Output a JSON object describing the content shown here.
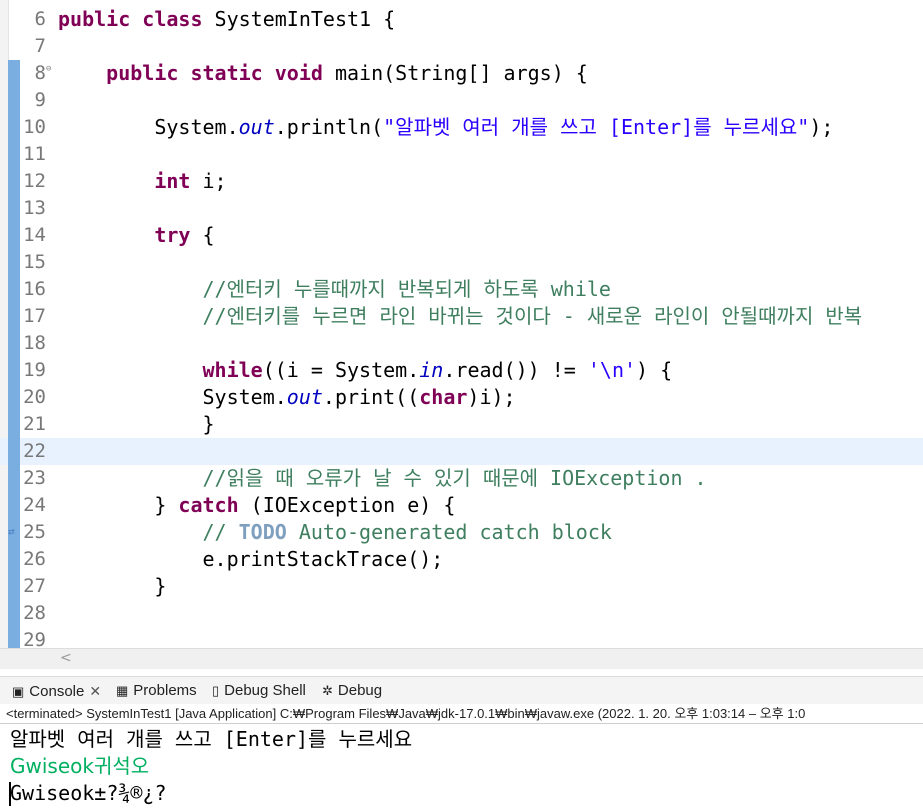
{
  "editor": {
    "lines": [
      {
        "n": "6",
        "tokens": [
          {
            "t": "public class",
            "c": "kw"
          },
          {
            "t": " SystemInTest1 {",
            "c": ""
          }
        ]
      },
      {
        "n": "7",
        "tokens": []
      },
      {
        "n": "8",
        "fold": "⊖",
        "tokens": [
          {
            "t": "    ",
            "c": ""
          },
          {
            "t": "public static void",
            "c": "kw"
          },
          {
            "t": " main(String[] args) {",
            "c": ""
          }
        ]
      },
      {
        "n": "9",
        "tokens": []
      },
      {
        "n": "10",
        "tokens": [
          {
            "t": "        System.",
            "c": ""
          },
          {
            "t": "out",
            "c": "fld"
          },
          {
            "t": ".println(",
            "c": ""
          },
          {
            "t": "\"알파벳 여러 개를 쓰고 [Enter]를 누르세요\"",
            "c": "str"
          },
          {
            "t": ");",
            "c": ""
          }
        ]
      },
      {
        "n": "11",
        "tokens": []
      },
      {
        "n": "12",
        "tokens": [
          {
            "t": "        ",
            "c": ""
          },
          {
            "t": "int",
            "c": "kw"
          },
          {
            "t": " i;",
            "c": ""
          }
        ]
      },
      {
        "n": "13",
        "tokens": []
      },
      {
        "n": "14",
        "tokens": [
          {
            "t": "        ",
            "c": ""
          },
          {
            "t": "try",
            "c": "kw"
          },
          {
            "t": " {",
            "c": ""
          }
        ]
      },
      {
        "n": "15",
        "tokens": []
      },
      {
        "n": "16",
        "tokens": [
          {
            "t": "            //엔터키 누를때까지 반복되게 하도록 while",
            "c": "cmt"
          }
        ]
      },
      {
        "n": "17",
        "tokens": [
          {
            "t": "            //엔터키를 누르면 라인 바뀌는 것이다 - 새로운 라인이 안될때까지 반복",
            "c": "cmt"
          }
        ]
      },
      {
        "n": "18",
        "tokens": []
      },
      {
        "n": "19",
        "tokens": [
          {
            "t": "            ",
            "c": ""
          },
          {
            "t": "while",
            "c": "kw"
          },
          {
            "t": "((i = System.",
            "c": ""
          },
          {
            "t": "in",
            "c": "fld"
          },
          {
            "t": ".read()) != ",
            "c": ""
          },
          {
            "t": "'\\n'",
            "c": "str"
          },
          {
            "t": ") {",
            "c": ""
          }
        ]
      },
      {
        "n": "20",
        "tokens": [
          {
            "t": "            System.",
            "c": ""
          },
          {
            "t": "out",
            "c": "fld"
          },
          {
            "t": ".print((",
            "c": ""
          },
          {
            "t": "char",
            "c": "kw"
          },
          {
            "t": ")i);",
            "c": ""
          }
        ]
      },
      {
        "n": "21",
        "tokens": [
          {
            "t": "            }",
            "c": ""
          }
        ]
      },
      {
        "n": "22",
        "current": true,
        "tokens": []
      },
      {
        "n": "23",
        "tokens": [
          {
            "t": "            //읽을 때 오류가 날 수 있기 때문에 IOException .",
            "c": "cmt"
          }
        ]
      },
      {
        "n": "24",
        "tokens": [
          {
            "t": "        } ",
            "c": ""
          },
          {
            "t": "catch",
            "c": "kw"
          },
          {
            "t": " (IOException e) {",
            "c": ""
          }
        ]
      },
      {
        "n": "25",
        "ann": "⇄",
        "tokens": [
          {
            "t": "            // ",
            "c": "cmt"
          },
          {
            "t": "TODO",
            "c": "todo"
          },
          {
            "t": " Auto-generated catch block",
            "c": "cmt"
          }
        ]
      },
      {
        "n": "26",
        "tokens": [
          {
            "t": "            e.printStackTrace();",
            "c": ""
          }
        ]
      },
      {
        "n": "27",
        "tokens": [
          {
            "t": "        }",
            "c": ""
          }
        ]
      },
      {
        "n": "28",
        "tokens": []
      },
      {
        "n": "29",
        "tokens": []
      }
    ]
  },
  "scroll": {
    "left_arrow": "<"
  },
  "tabs": [
    {
      "icon": "▣",
      "label": "Console",
      "close": "✕",
      "icon_name": "console-icon"
    },
    {
      "icon": "▦",
      "label": "Problems",
      "icon_name": "problems-icon"
    },
    {
      "icon": "▯",
      "label": "Debug Shell",
      "icon_name": "debug-shell-icon"
    },
    {
      "icon": "✲",
      "label": "Debug",
      "icon_name": "debug-icon"
    }
  ],
  "status": "<terminated> SystemInTest1 [Java Application] C:₩Program Files₩Java₩jdk-17.0.1₩bin₩javaw.exe  (2022. 1. 20. 오후 1:03:14 – 오후 1:0",
  "console": [
    {
      "text": "알파벳 여러 개를 쓰고 [Enter]를 누르세요",
      "kind": "out"
    },
    {
      "text": "Gwiseok귀석오",
      "kind": "in"
    },
    {
      "text": "Gwiseok±?¾®¿?",
      "kind": "out"
    }
  ],
  "colors": {
    "keyword": "#7f0055",
    "string": "#2a00ff",
    "comment": "#3f7f5f",
    "field": "#0000c0",
    "input": "#00b060",
    "current_line": "#e8f2fe",
    "diff_bar": "#7aaee0"
  }
}
